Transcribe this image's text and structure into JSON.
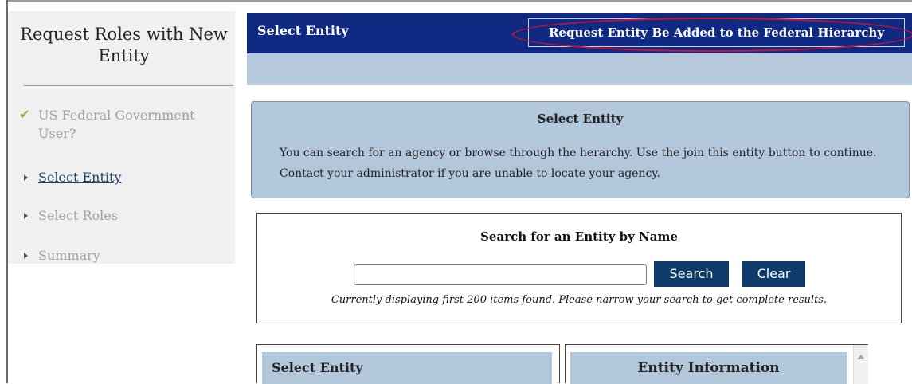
{
  "sidebar": {
    "title": "Request Roles with New Entity",
    "items": [
      {
        "label": "US Federal Government User?",
        "state": "completed"
      },
      {
        "label": "Select Entity",
        "state": "active"
      },
      {
        "label": "Select Roles",
        "state": "pending"
      },
      {
        "label": "Summary",
        "state": "pending"
      }
    ]
  },
  "header": {
    "title": "Select Entity",
    "request_button": "Request Entity Be Added to the Federal Hierarchy"
  },
  "info": {
    "title": "Select Entity",
    "text": "You can search for an agency or browse through the herarchy. Use the join this entity button to continue. Contact your administrator if you are unable to locate your agency."
  },
  "search": {
    "title": "Search for an Entity by Name",
    "input_value": "",
    "search_button": "Search",
    "clear_button": "Clear",
    "note": "Currently displaying first 200 items found. Please narrow your search to get complete results."
  },
  "panels": {
    "left_title": "Select Entity",
    "right_title": "Entity Information"
  },
  "colors": {
    "header_bg": "#102a84",
    "subbar_bg": "#b5c8dc",
    "panel_bg": "#b3c7db",
    "button_bg": "#0e3b6a",
    "highlight": "#d0112b",
    "check": "#7ab33e"
  }
}
